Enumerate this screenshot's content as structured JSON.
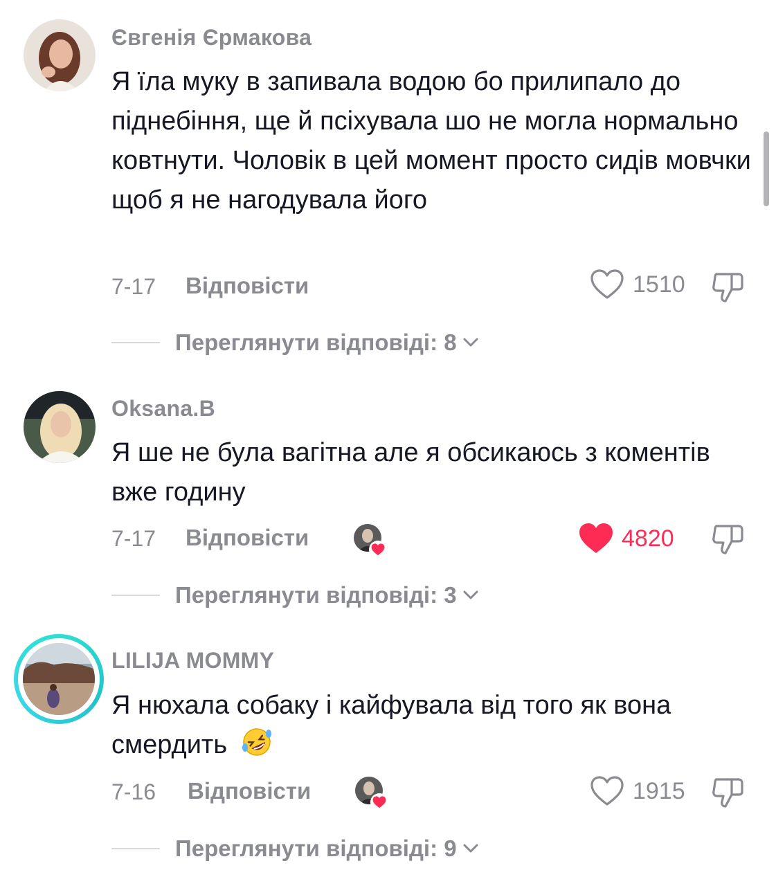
{
  "comments": [
    {
      "username": "Євгенія Єрмакова",
      "text": "Я їла муку в запивала водою бо прилипало до піднебіння, ще й псіхувала шо не могла нормально ковтнути. Чоловік в цей момент просто сидів мовчки щоб я не нагодувала його",
      "date": "7-17",
      "reply_label": "Відповісти",
      "likes": "1510",
      "liked": false,
      "view_replies": "Переглянути відповіді: 8"
    },
    {
      "username": "Oksana.B",
      "text": "Я ше не була вагітна але я обсикаюсь з коментів вже годину",
      "date": "7-17",
      "reply_label": "Відповісти",
      "likes": "4820",
      "liked": true,
      "view_replies": "Переглянути відповіді: 3"
    },
    {
      "username": "LILIJA MOMMY",
      "text": "Я нюхала собаку і кайфувала від того як вона смердить",
      "emoji": "🤣",
      "date": "7-16",
      "reply_label": "Відповісти",
      "likes": "1915",
      "liked": false,
      "view_replies": "Переглянути відповіді: 9"
    }
  ],
  "colors": {
    "text": "#161823",
    "muted": "#8a8b91",
    "like_active": "#fe2c55",
    "story_ring": "#2fe0d2"
  },
  "icons": [
    "heart-outline-icon",
    "heart-filled-icon",
    "thumbs-down-icon",
    "chevron-down-icon"
  ]
}
